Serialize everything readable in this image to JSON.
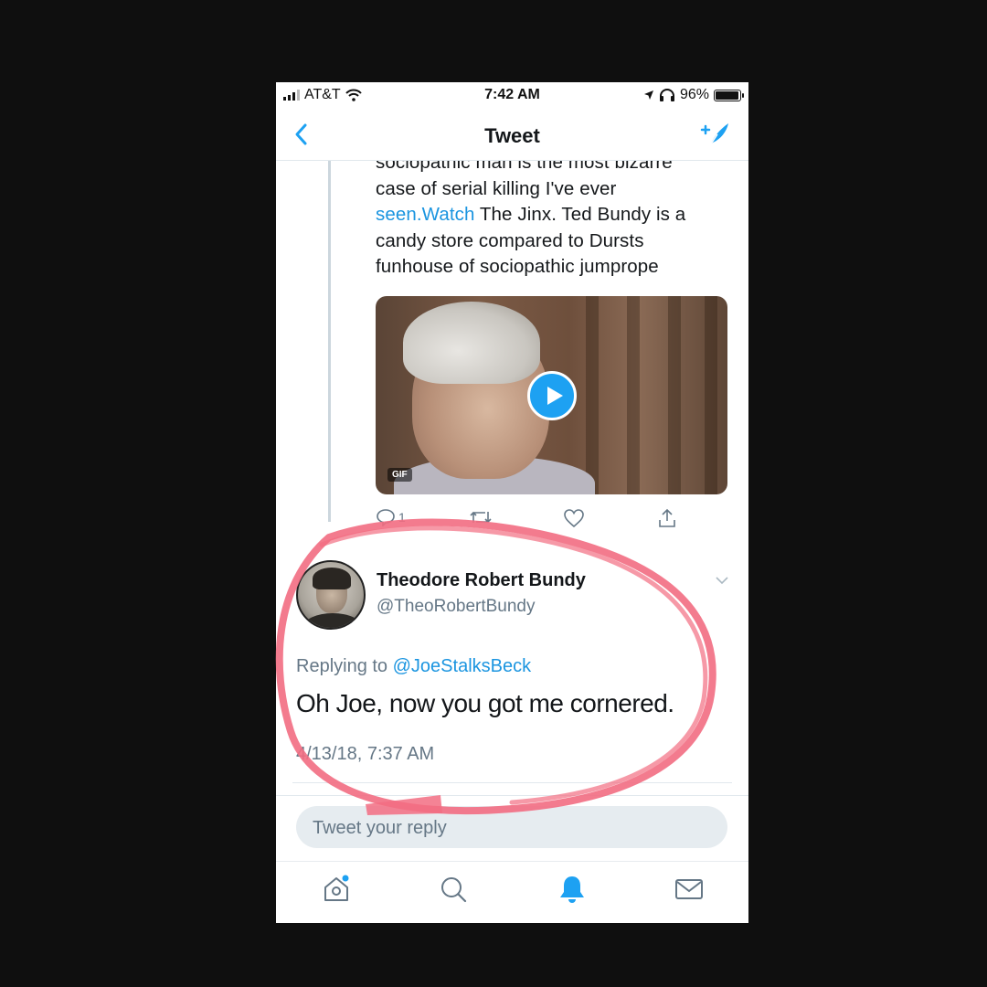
{
  "status_bar": {
    "carrier": "AT&T",
    "time": "7:42 AM",
    "battery": "96%",
    "battery_level": 0.96
  },
  "nav": {
    "title": "Tweet",
    "back_icon": "chevron-left-icon",
    "compose_icon": "compose-tweet-icon"
  },
  "previous_tweet": {
    "line1": "sociopathic man is the most bizarre",
    "line2": "case of serial killing I've ever",
    "line3_link": "seen.Watch",
    "line3_rest": " The Jinx. Ted Bundy is a",
    "line4": "candy store compared to Dursts",
    "line5": "funhouse of sociopathic jumprope",
    "media_badge": "GIF",
    "reply_count": "1"
  },
  "tweet": {
    "author_name": "Theodore Robert Bundy",
    "author_handle": "@TheoRobertBundy",
    "replying_prefix": "Replying to ",
    "replying_to": "@JoeStalksBeck",
    "text": "Oh Joe, now you got me cornered.",
    "timestamp": "4/13/18, 7:37 AM"
  },
  "reply_input": {
    "placeholder": "Tweet your reply"
  },
  "tabbar": {
    "tabs": [
      {
        "icon": "home-icon",
        "has_badge": true
      },
      {
        "icon": "search-icon"
      },
      {
        "icon": "notifications-bell-icon",
        "active": true
      },
      {
        "icon": "messages-mail-icon"
      }
    ]
  },
  "colors": {
    "accent": "#1da1f2",
    "link": "#1b95e0",
    "annotation_circle": "#f26d82"
  }
}
